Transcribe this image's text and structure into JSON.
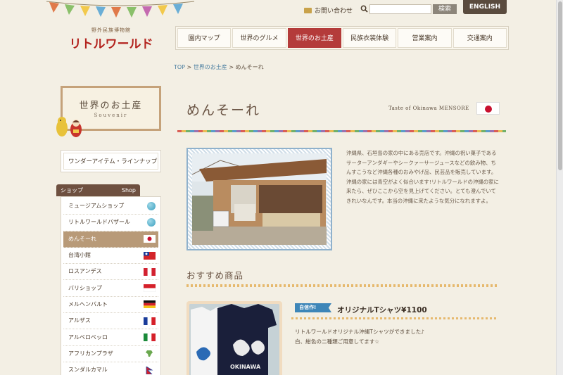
{
  "header": {
    "logo_sub": "野外民族博物館",
    "logo_main": "リトルワールド",
    "contact_label": "お問い合わせ",
    "search_placeholder": "",
    "search_button": "検索",
    "english_button": "ENGLISH"
  },
  "nav": {
    "items": [
      {
        "label": "園内マップ"
      },
      {
        "label": "世界のグルメ"
      },
      {
        "label": "世界のお土産"
      },
      {
        "label": "民族衣装体験"
      },
      {
        "label": "営業案内"
      },
      {
        "label": "交通案内"
      }
    ],
    "active_index": 2
  },
  "breadcrumb": {
    "top": "TOP",
    "sep1": " > ",
    "parent": "世界のお土産",
    "sep2": " > ",
    "current": "めんそーれ"
  },
  "sidebar": {
    "souvenir_title": "世界のお土産",
    "souvenir_sub": "Souvenir",
    "lineup_label": "ワンダーアイテム・ラインナップ",
    "shop_header_jp": "ショップ",
    "shop_header_en": "Shop",
    "shops": [
      {
        "label": "ミュージアムショップ",
        "icon": "globe"
      },
      {
        "label": "リトルワールドバザール",
        "icon": "globe"
      },
      {
        "label": "めんそーれ",
        "icon": "flag-japan"
      },
      {
        "label": "台湾小館",
        "icon": "flag-taiwan"
      },
      {
        "label": "ロスアンデス",
        "icon": "flag-peru"
      },
      {
        "label": "バリショップ",
        "icon": "flag-indonesia"
      },
      {
        "label": "メルヘンバルト",
        "icon": "flag-germany"
      },
      {
        "label": "アルザス",
        "icon": "flag-france"
      },
      {
        "label": "アルベロベッロ",
        "icon": "flag-italy"
      },
      {
        "label": "アフリカンプラザ",
        "icon": "africa-map"
      },
      {
        "label": "スンダルカマル",
        "icon": "flag-nepal"
      }
    ],
    "active_shop_index": 2
  },
  "main": {
    "title": "めんそーれ",
    "title_en": "Taste of Okinawa MENSORE",
    "description": "沖縄県、石垣島の家の中にある売店です。沖縄の祝い菓子であるサーターアンダギーやシークァーサージュースなどの飲み物、ちんすこうなど沖縄各種のおみやげ品、民芸品を販売しています。沖縄の家には青空がよく似合います!リトルワールドの沖縄の家に来たら、ぜひここから空を見上げてください。とても澄んでいてきれいなんです。本当の沖縄に来たような気分になれますよ。",
    "recommend_title": "おすすめ商品",
    "product": {
      "badge": "自信作!",
      "name": "オリジナルTシャツ¥1100",
      "desc_line1": "リトルワールドオリジナル沖縄Tシャツができました♪",
      "desc_line2": "白、紺色の二種類ご用意してます☆",
      "shirt_text": "OKINAWA"
    }
  },
  "colors": {
    "accent_red": "#b43b3a",
    "brown": "#6e5040",
    "link_blue": "#4a7ea0"
  }
}
